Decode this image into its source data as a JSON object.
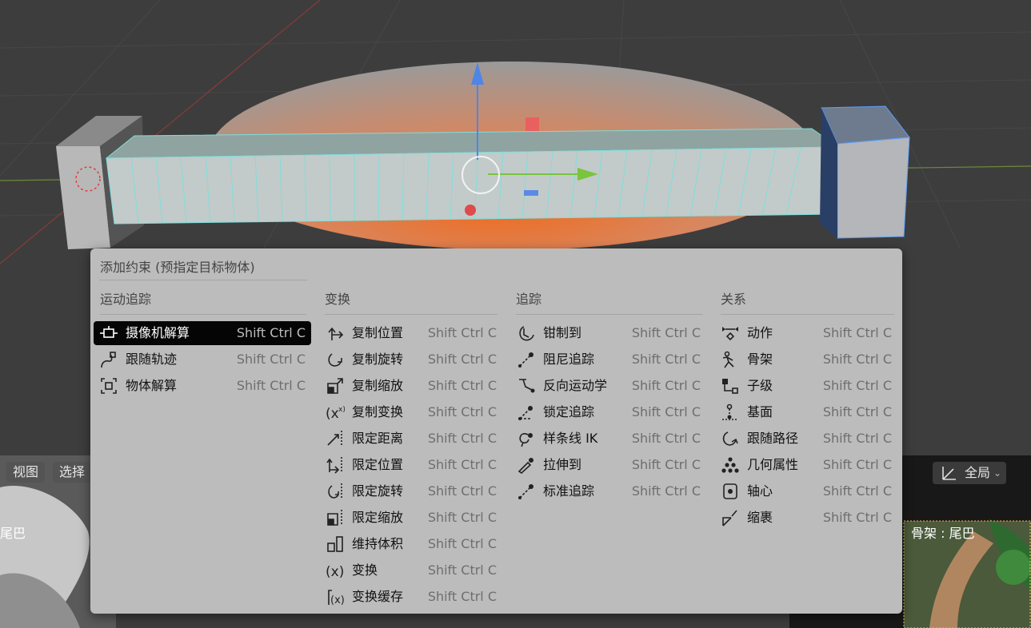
{
  "menu": {
    "title": "添加约束 (预指定目标物体)",
    "columns": [
      {
        "heading": "运动追踪",
        "items": [
          {
            "label": "摄像机解算",
            "shortcut": "Shift Ctrl C",
            "icon": "camera-solver-icon",
            "active": true
          },
          {
            "label": "跟随轨迹",
            "shortcut": "Shift Ctrl C",
            "icon": "follow-track-icon"
          },
          {
            "label": "物体解算",
            "shortcut": "Shift Ctrl C",
            "icon": "object-solver-icon"
          }
        ]
      },
      {
        "heading": "变换",
        "items": [
          {
            "label": "复制位置",
            "shortcut": "Shift Ctrl C",
            "icon": "copy-location-icon"
          },
          {
            "label": "复制旋转",
            "shortcut": "Shift Ctrl C",
            "icon": "copy-rotation-icon"
          },
          {
            "label": "复制缩放",
            "shortcut": "Shift Ctrl C",
            "icon": "copy-scale-icon"
          },
          {
            "label": "复制变换",
            "shortcut": "Shift Ctrl C",
            "icon": "copy-transforms-icon"
          },
          {
            "label": "限定距离",
            "shortcut": "Shift Ctrl C",
            "icon": "limit-distance-icon"
          },
          {
            "label": "限定位置",
            "shortcut": "Shift Ctrl C",
            "icon": "limit-location-icon"
          },
          {
            "label": "限定旋转",
            "shortcut": "Shift Ctrl C",
            "icon": "limit-rotation-icon"
          },
          {
            "label": "限定缩放",
            "shortcut": "Shift Ctrl C",
            "icon": "limit-scale-icon"
          },
          {
            "label": "维持体积",
            "shortcut": "Shift Ctrl C",
            "icon": "maintain-volume-icon"
          },
          {
            "label": "变换",
            "shortcut": "Shift Ctrl C",
            "icon": "transformation-icon"
          },
          {
            "label": "变换缓存",
            "shortcut": "Shift Ctrl C",
            "icon": "transform-cache-icon"
          }
        ]
      },
      {
        "heading": "追踪",
        "items": [
          {
            "label": "钳制到",
            "shortcut": "Shift Ctrl C",
            "icon": "clamp-to-icon"
          },
          {
            "label": "阻尼追踪",
            "shortcut": "Shift Ctrl C",
            "icon": "damped-track-icon"
          },
          {
            "label": "反向运动学",
            "shortcut": "Shift Ctrl C",
            "icon": "inverse-kinematics-icon"
          },
          {
            "label": "锁定追踪",
            "shortcut": "Shift Ctrl C",
            "icon": "locked-track-icon"
          },
          {
            "label": "样条线 IK",
            "shortcut": "Shift Ctrl C",
            "icon": "spline-ik-icon"
          },
          {
            "label": "拉伸到",
            "shortcut": "Shift Ctrl C",
            "icon": "stretch-to-icon"
          },
          {
            "label": "标准追踪",
            "shortcut": "Shift Ctrl C",
            "icon": "track-to-icon"
          }
        ]
      },
      {
        "heading": "关系",
        "items": [
          {
            "label": "动作",
            "shortcut": "Shift Ctrl C",
            "icon": "action-icon"
          },
          {
            "label": "骨架",
            "shortcut": "Shift Ctrl C",
            "icon": "armature-icon"
          },
          {
            "label": "子级",
            "shortcut": "Shift Ctrl C",
            "icon": "child-of-icon"
          },
          {
            "label": "基面",
            "shortcut": "Shift Ctrl C",
            "icon": "floor-icon"
          },
          {
            "label": "跟随路径",
            "shortcut": "Shift Ctrl C",
            "icon": "follow-path-icon"
          },
          {
            "label": "几何属性",
            "shortcut": "Shift Ctrl C",
            "icon": "geometry-attribute-icon"
          },
          {
            "label": "轴心",
            "shortcut": "Shift Ctrl C",
            "icon": "pivot-icon"
          },
          {
            "label": "缩裹",
            "shortcut": "Shift Ctrl C",
            "icon": "shrinkwrap-icon"
          }
        ]
      }
    ]
  },
  "lower_left": {
    "view_label": "视图",
    "select_label": "选择",
    "bone_label": "尾巴"
  },
  "lower_right": {
    "transform_space": "全局",
    "bone_label": "骨架 : 尾巴"
  }
}
